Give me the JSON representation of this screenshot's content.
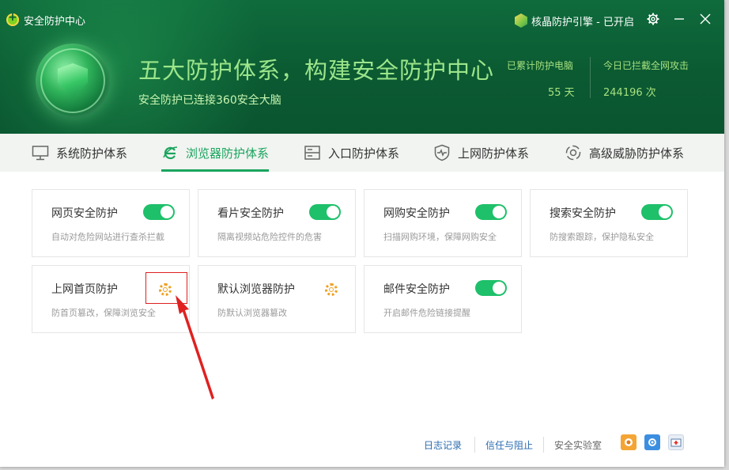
{
  "app": {
    "title": "安全防护中心"
  },
  "header": {
    "engine_status": "核晶防护引擎 - 已开启",
    "headline": "五大防护体系，构建安全防护中心",
    "subline": "安全防护已连接360安全大脑",
    "stats": [
      {
        "label": "已累计防护电脑",
        "value": "55 天"
      },
      {
        "label": "今日已拦截全网攻击",
        "value": "244196 次"
      }
    ]
  },
  "tabs": [
    {
      "label": "系统防护体系",
      "icon": "monitor-icon",
      "active": false
    },
    {
      "label": "浏览器防护体系",
      "icon": "browser-e-icon",
      "active": true
    },
    {
      "label": "入口防护体系",
      "icon": "entry-box-icon",
      "active": false
    },
    {
      "label": "上网防护体系",
      "icon": "shield-pulse-icon",
      "active": false
    },
    {
      "label": "高级威胁防护体系",
      "icon": "threat-target-icon",
      "active": false
    }
  ],
  "cards": [
    {
      "title": "网页安全防护",
      "desc": "自动对危险网站进行查杀拦截",
      "control": "toggle",
      "on": true
    },
    {
      "title": "看片安全防护",
      "desc": "隔离视频站危险控件的危害",
      "control": "toggle",
      "on": true
    },
    {
      "title": "网购安全防护",
      "desc": "扫描网购环境，保障网购安全",
      "control": "toggle",
      "on": true
    },
    {
      "title": "搜索安全防护",
      "desc": "防搜索跟踪，保护隐私安全",
      "control": "toggle",
      "on": true
    },
    {
      "title": "上网首页防护",
      "desc": "防首页篡改，保障浏览安全",
      "control": "settings"
    },
    {
      "title": "默认浏览器防护",
      "desc": "防默认浏览器篡改",
      "control": "settings"
    },
    {
      "title": "邮件安全防护",
      "desc": "开启邮件危险链接提醒",
      "control": "toggle",
      "on": true
    }
  ],
  "footer": {
    "log": "日志记录",
    "trust": "信任与阻止",
    "lab": "安全实验室"
  },
  "colors": {
    "header_bg": "#0b5a32",
    "accent": "#1aa55e",
    "toggle_on": "#1ec06a",
    "settings_icon": "#f0a020",
    "annotation": "#e02020"
  }
}
